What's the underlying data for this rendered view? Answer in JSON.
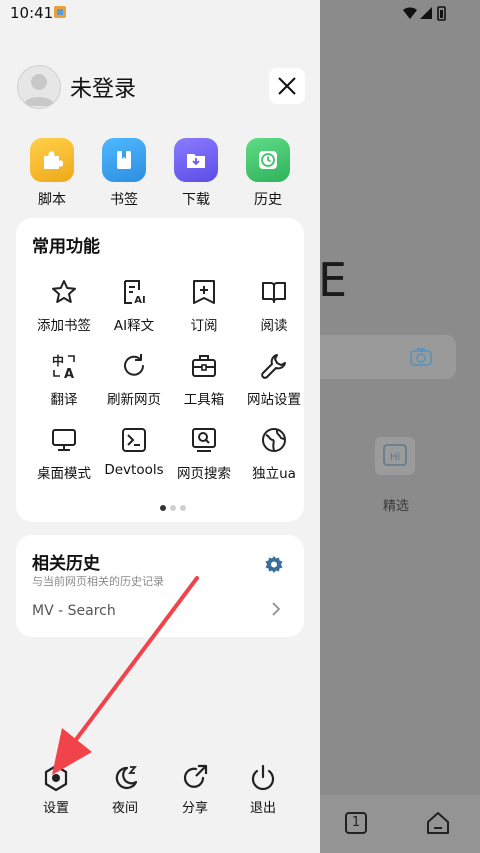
{
  "status_bar": {
    "time": "10:41"
  },
  "account": {
    "username": "未登录"
  },
  "quick_actions": [
    {
      "label": "脚本",
      "icon": "puzzle-icon",
      "color": "#f5b82e"
    },
    {
      "label": "书签",
      "icon": "bookmark-book-icon",
      "color": "#3aa0ee"
    },
    {
      "label": "下载",
      "icon": "download-folder-icon",
      "color": "#6a5cf0"
    },
    {
      "label": "历史",
      "icon": "history-clock-icon",
      "color": "#3cc46a"
    }
  ],
  "common_functions": {
    "title": "常用功能",
    "items": [
      {
        "label": "添加书签",
        "icon": "star-icon"
      },
      {
        "label": "AI释文",
        "icon": "ai-document-icon"
      },
      {
        "label": "订阅",
        "icon": "subscribe-add-icon"
      },
      {
        "label": "阅读",
        "icon": "book-open-icon"
      },
      {
        "label": "翻译",
        "icon": "translate-icon"
      },
      {
        "label": "刷新网页",
        "icon": "refresh-icon"
      },
      {
        "label": "工具箱",
        "icon": "toolbox-icon"
      },
      {
        "label": "网站设置",
        "icon": "wrench-icon"
      },
      {
        "label": "桌面模式",
        "icon": "desktop-icon"
      },
      {
        "label": "Devtools",
        "icon": "terminal-icon"
      },
      {
        "label": "网页搜索",
        "icon": "page-search-icon"
      },
      {
        "label": "独立ua",
        "icon": "globe-icon"
      }
    ],
    "page_count": 3,
    "current_page": 1
  },
  "related_history": {
    "title": "相关历史",
    "subtitle": "与当前网页相关的历史记录",
    "entry": "MV - Search"
  },
  "bottom_bar": [
    {
      "label": "设置",
      "icon": "settings-hex-icon"
    },
    {
      "label": "夜间",
      "icon": "night-moon-icon"
    },
    {
      "label": "分享",
      "icon": "share-icon"
    },
    {
      "label": "退出",
      "icon": "power-icon"
    }
  ],
  "background_page": {
    "logo_letter": "E",
    "card_label": "精选",
    "tab_count": "1"
  }
}
